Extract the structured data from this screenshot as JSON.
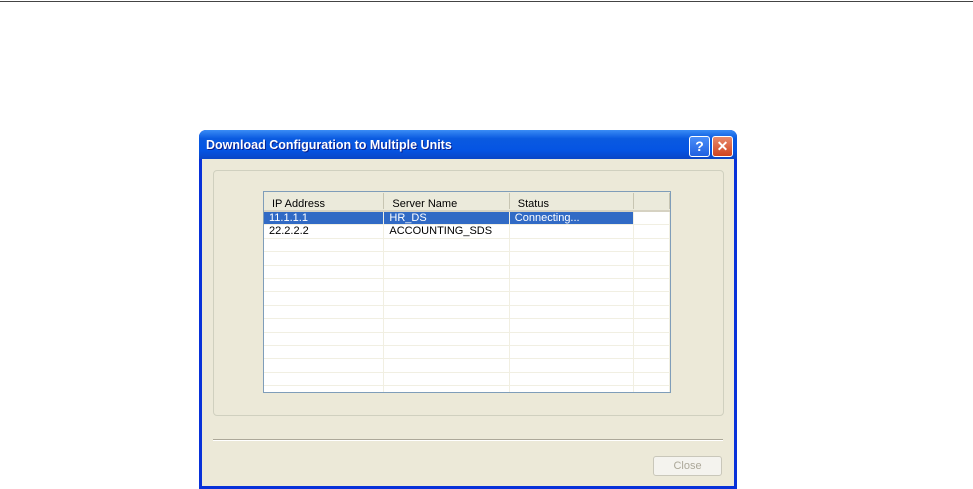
{
  "window": {
    "title": "Download Configuration to Multiple Units",
    "help_label": "?",
    "close_label": "✕"
  },
  "list": {
    "columns": [
      "IP Address",
      "Server Name",
      "Status",
      ""
    ],
    "rows": [
      {
        "ip": "11.1.1.1",
        "server": "HR_DS",
        "status": "Connecting...",
        "selected": true
      },
      {
        "ip": "22.2.2.2",
        "server": "ACCOUNTING_SDS",
        "status": "",
        "selected": false
      }
    ]
  },
  "buttons": {
    "close": "Close"
  }
}
